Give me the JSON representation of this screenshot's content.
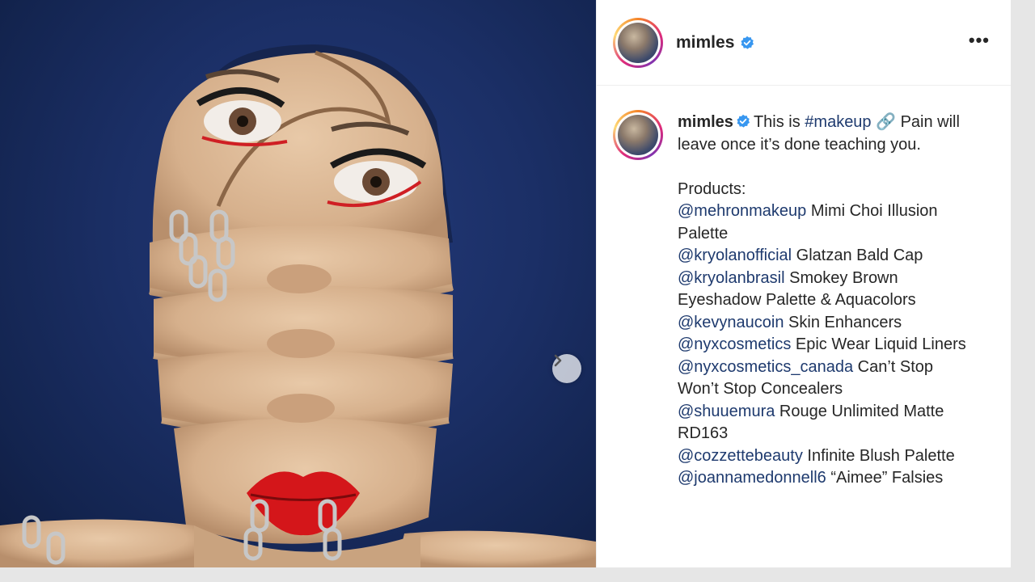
{
  "post": {
    "username": "mimles",
    "verified": true,
    "more_icon": "ellipsis-horizontal-icon",
    "next_icon": "chevron-right-icon"
  },
  "caption": {
    "username": "mimles",
    "text_before_tag": "This is ",
    "hashtag": "#makeup",
    "emoji": "🔗",
    "text_after_emoji": " Pain will leave once it’s done teaching you.",
    "products_label": "Products:",
    "products": [
      {
        "handle": "@mehronmakeup",
        "text": " Mimi Choi Illusion Palette"
      },
      {
        "handle": "@kryolanofficial",
        "text": " Glatzan Bald Cap"
      },
      {
        "handle": "@kryolanbrasil",
        "text": " Smokey Brown Eyeshadow Palette & Aquacolors"
      },
      {
        "handle": "@kevynaucoin",
        "text": " Skin Enhancers"
      },
      {
        "handle": "@nyxcosmetics",
        "text": " Epic Wear Liquid Liners"
      },
      {
        "handle": "@nyxcosmetics_canada",
        "text": " Can’t Stop Won’t Stop Concealers"
      },
      {
        "handle": "@shuuemura",
        "text": " Rouge Unlimited Matte RD163"
      },
      {
        "handle": "@cozzettebeauty",
        "text": " Infinite Blush Palette"
      },
      {
        "handle": "@joannamedonnell6",
        "text": " “Aimee” Falsies"
      }
    ]
  },
  "colors": {
    "link": "#1e3a6e",
    "verified": "#3897f0",
    "background_blue": "#1b2f66"
  }
}
